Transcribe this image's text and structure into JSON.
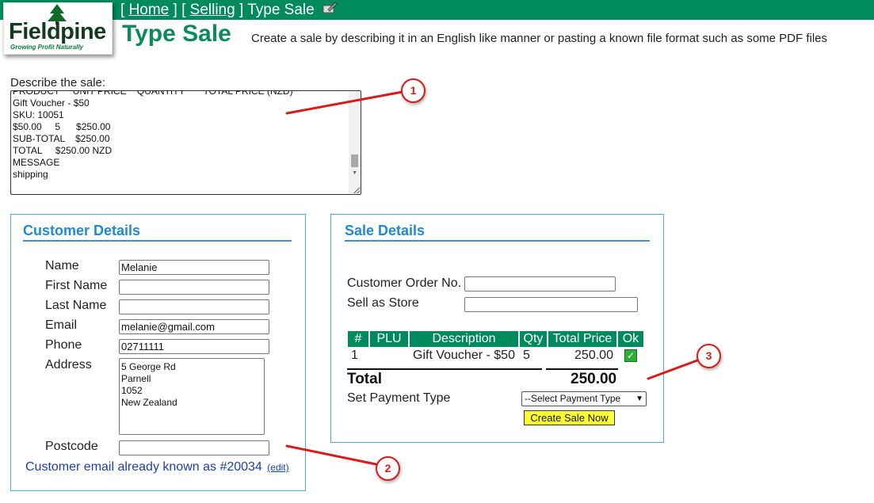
{
  "header": {
    "crumb_home": "Home",
    "crumb_selling": "Selling",
    "crumb_current": "Type Sale",
    "logo_name": "Fieldpine",
    "logo_tagline": "Growing Profit Naturally",
    "page_title": "Type Sale",
    "page_description": "Create a sale by describing it in an English like manner or pasting a known file format such as some PDF files"
  },
  "describe": {
    "label": "Describe the sale:",
    "text": "PRODUCT     UNIT PRICE    QUANTITY       TOTAL PRICE (NZD)\nGift Voucher - $50\nSKU: 10051\n$50.00     5      $250.00\nSUB-TOTAL    $250.00\nTOTAL     $250.00 NZD\nMESSAGE\nshipping"
  },
  "customer": {
    "title": "Customer Details",
    "name_label": "Name",
    "name_value": "Melanie",
    "first_name_label": "First Name",
    "first_name_value": "",
    "last_name_label": "Last Name",
    "last_name_value": "",
    "email_label": "Email",
    "email_value": "melanie@gmail.com",
    "phone_label": "Phone",
    "phone_value": "02711111",
    "address_label": "Address",
    "address_value": "5 George Rd\nParnell\n1052\nNew Zealand",
    "postcode_label": "Postcode",
    "postcode_value": "",
    "known_message": "Customer email already known as #20034",
    "edit_link": "(edit)"
  },
  "sale": {
    "title": "Sale Details",
    "order_no_label": "Customer Order No.",
    "order_no_value": "",
    "sell_as_store_label": "Sell as Store",
    "sell_as_store_value": "",
    "columns": {
      "num": "#",
      "plu": "PLU",
      "description": "Description",
      "qty": "Qty",
      "total_price": "Total Price",
      "ok": "Ok"
    },
    "items": [
      {
        "num": "1",
        "plu": "",
        "description": "Gift Voucher - $50",
        "qty": "5",
        "total_price": "250.00",
        "ok_checked": true
      }
    ],
    "total_label": "Total",
    "total_value": "250.00",
    "payment_label": "Set Payment Type",
    "payment_selected": "--Select Payment Type",
    "create_button": "Create Sale Now"
  },
  "annotations": {
    "callout_1": "1",
    "callout_2": "2",
    "callout_3": "3",
    "color": "#d81b1b"
  },
  "colors": {
    "brand_green": "#008a5e",
    "panel_blue": "#1e8ad6",
    "button_yellow": "#ffff33"
  }
}
